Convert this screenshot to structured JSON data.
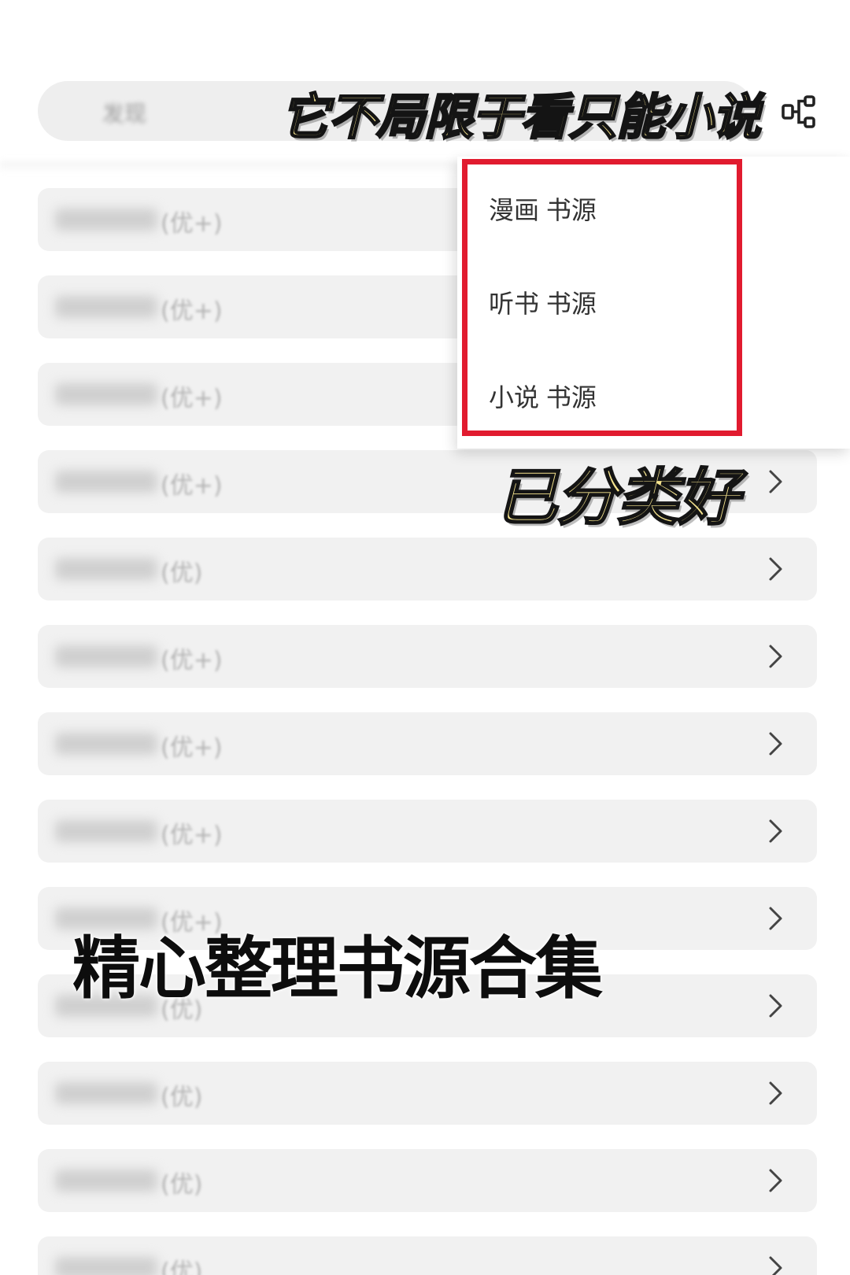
{
  "search": {
    "placeholder": "发现"
  },
  "header": {
    "menu_icon": "node-tree-icon"
  },
  "dropdown": {
    "items": [
      {
        "label": "漫画 书源"
      },
      {
        "label": "听书 书源"
      },
      {
        "label": "小说 书源"
      }
    ]
  },
  "list": {
    "rows": [
      {
        "grade": "(优+)"
      },
      {
        "grade": "(优+)"
      },
      {
        "grade": "(优+)"
      },
      {
        "grade": "(优+)"
      },
      {
        "grade": "(优)"
      },
      {
        "grade": "(优+)"
      },
      {
        "grade": "(优+)"
      },
      {
        "grade": "(优+)"
      },
      {
        "grade": "(优+)"
      },
      {
        "grade": "(优)"
      },
      {
        "grade": "(优)"
      },
      {
        "grade": "(优)"
      },
      {
        "grade": "(优)"
      }
    ],
    "chevron_icon": "chevron-right-icon"
  },
  "captions": {
    "top": "它不局限于看只能小说",
    "sorted": "已分类好",
    "collection": "精心整理书源合集"
  },
  "colors": {
    "highlight": "#e11b2f",
    "caption_yellow": "#f6e48e",
    "row_background": "#f1f1f1"
  }
}
